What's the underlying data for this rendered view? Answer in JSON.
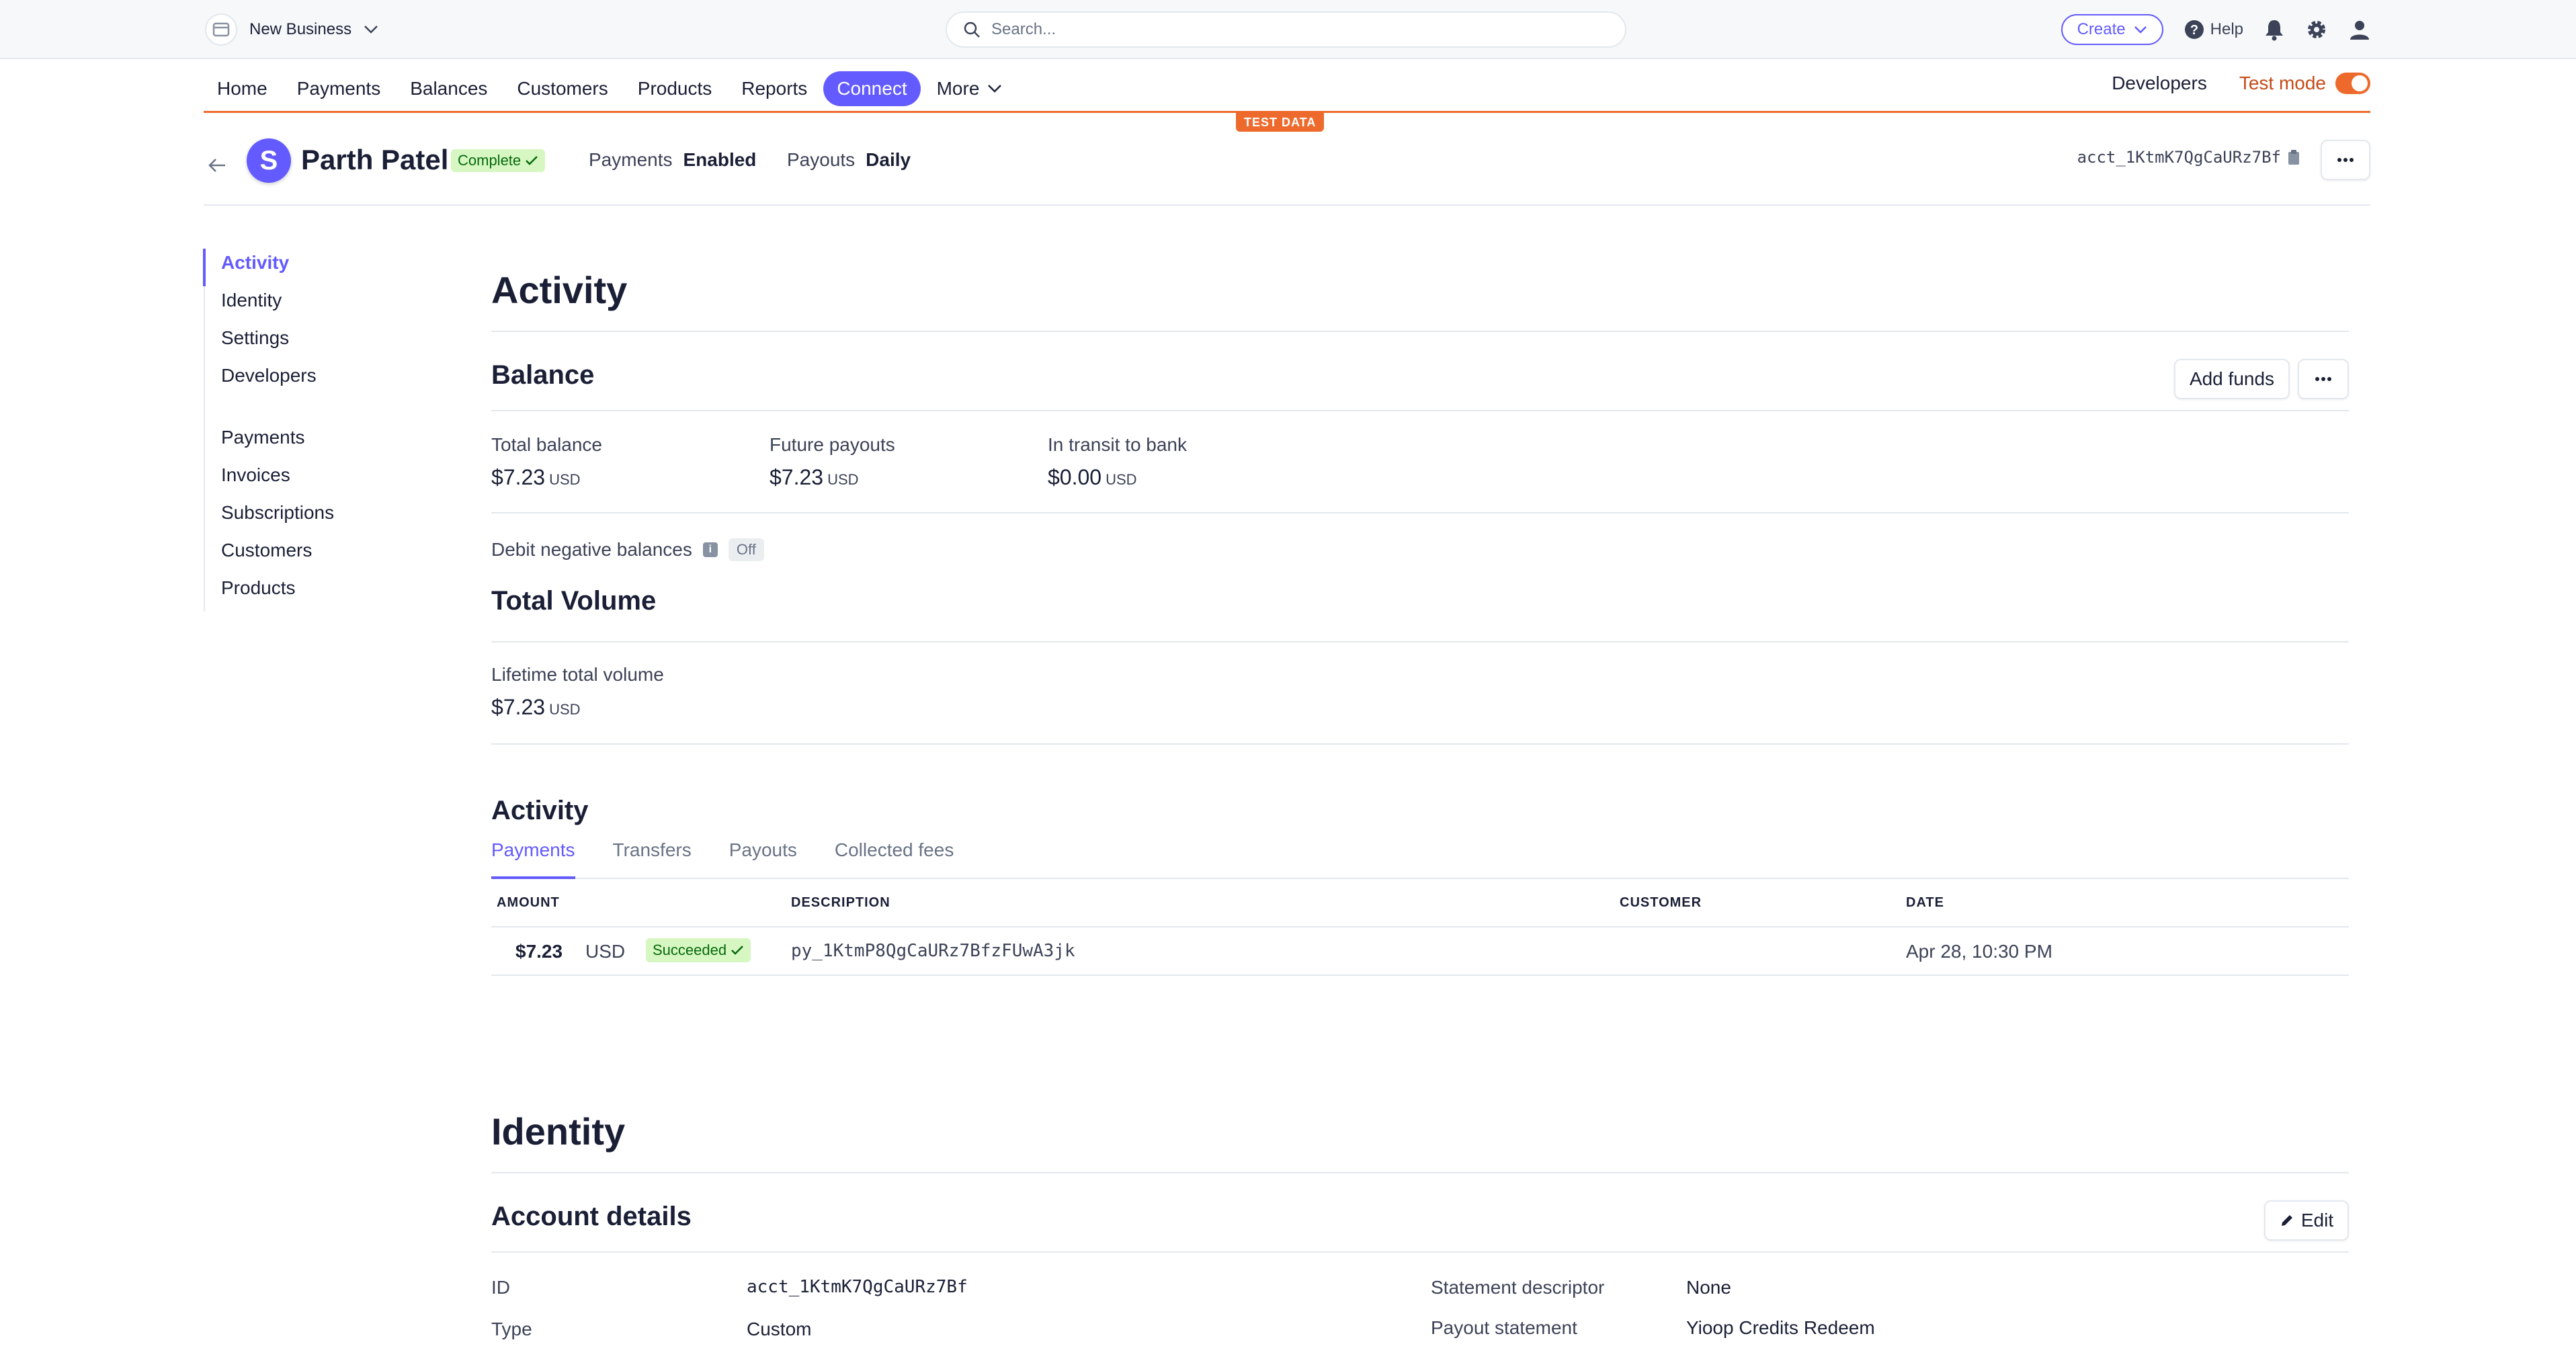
{
  "topbar": {
    "account_name": "New Business",
    "search_placeholder": "Search...",
    "create_label": "Create",
    "help_label": "Help"
  },
  "nav": {
    "items": [
      "Home",
      "Payments",
      "Balances",
      "Customers",
      "Products",
      "Reports",
      "Connect"
    ],
    "more_label": "More",
    "developers_label": "Developers",
    "test_mode_label": "Test mode",
    "test_mode_on": true,
    "active": "Connect"
  },
  "banner": {
    "test_data": "TEST DATA"
  },
  "account_header": {
    "avatar_letter": "S",
    "name": "Parth Patel",
    "status": "Complete",
    "payments_label": "Payments",
    "payments_value": "Enabled",
    "payouts_label": "Payouts",
    "payouts_value": "Daily",
    "account_id": "acct_1KtmK7QgCaURz7Bf"
  },
  "sidebar": {
    "group1": [
      "Activity",
      "Identity",
      "Settings",
      "Developers"
    ],
    "group2": [
      "Payments",
      "Invoices",
      "Subscriptions",
      "Customers",
      "Products"
    ],
    "active": "Activity"
  },
  "activity": {
    "title": "Activity",
    "balance": {
      "title": "Balance",
      "add_funds_label": "Add funds",
      "stats": [
        {
          "label": "Total balance",
          "value": "$7.23",
          "currency": "USD"
        },
        {
          "label": "Future payouts",
          "value": "$7.23",
          "currency": "USD"
        },
        {
          "label": "In transit to bank",
          "value": "$0.00",
          "currency": "USD"
        }
      ],
      "debit_label": "Debit negative balances",
      "debit_value": "Off"
    },
    "volume": {
      "title": "Total Volume",
      "label": "Lifetime total volume",
      "value": "$7.23",
      "currency": "USD"
    },
    "subsection": {
      "title": "Activity",
      "tabs": [
        "Payments",
        "Transfers",
        "Payouts",
        "Collected fees"
      ],
      "active_tab": "Payments",
      "columns": [
        "AMOUNT",
        "DESCRIPTION",
        "CUSTOMER",
        "DATE"
      ],
      "rows": [
        {
          "amount": "$7.23",
          "currency": "USD",
          "status": "Succeeded",
          "description": "py_1KtmP8QgCaURz7BfzFUwA3jk",
          "customer": "",
          "date": "Apr 28, 10:30 PM"
        }
      ]
    }
  },
  "identity": {
    "title": "Identity",
    "account_details": {
      "title": "Account details",
      "edit_label": "Edit",
      "id_label": "ID",
      "id_value": "acct_1KtmK7QgCaURz7Bf",
      "type_label": "Type",
      "type_value": "Custom",
      "statement_descriptor_label": "Statement descriptor",
      "statement_descriptor_value": "None",
      "payout_statement_label": "Payout statement",
      "payout_statement_value": "Yioop Credits Redeem"
    }
  },
  "colors": {
    "accent": "#635bff",
    "test_mode": "#ed6a2c",
    "success_bg": "#d7f7c2",
    "success_text": "#05690d"
  }
}
